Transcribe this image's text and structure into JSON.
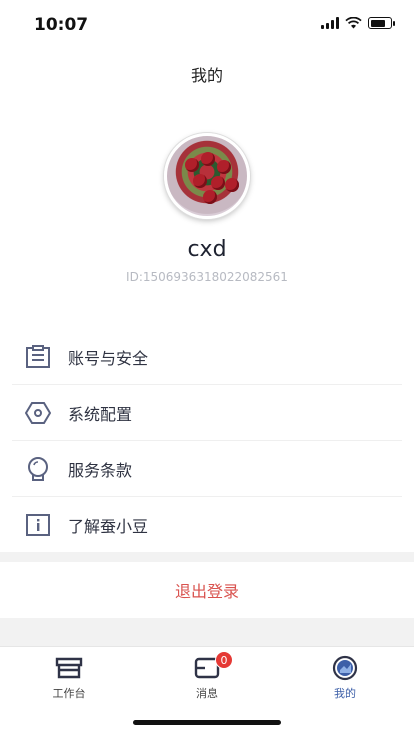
{
  "status_bar": {
    "time": "10:07"
  },
  "nav": {
    "title": "我的"
  },
  "profile": {
    "username": "cxd",
    "user_id": "ID:1506936318022082561"
  },
  "menu": [
    {
      "label": "账号与安全",
      "icon": "account-security-icon"
    },
    {
      "label": "系统配置",
      "icon": "settings-hexagon-icon"
    },
    {
      "label": "服务条款",
      "icon": "terms-icon"
    },
    {
      "label": "了解蚕小豆",
      "icon": "info-icon"
    }
  ],
  "logout": {
    "label": "退出登录"
  },
  "tabs": [
    {
      "label": "工作台",
      "icon": "workbench-icon",
      "active": false
    },
    {
      "label": "消息",
      "icon": "message-icon",
      "badge": "0",
      "active": false
    },
    {
      "label": "我的",
      "icon": "profile-icon",
      "active": true
    }
  ],
  "colors": {
    "accent": "#3d5fa8",
    "logout": "#d9534f",
    "badge": "#e53935",
    "icon": "#5a6280"
  }
}
